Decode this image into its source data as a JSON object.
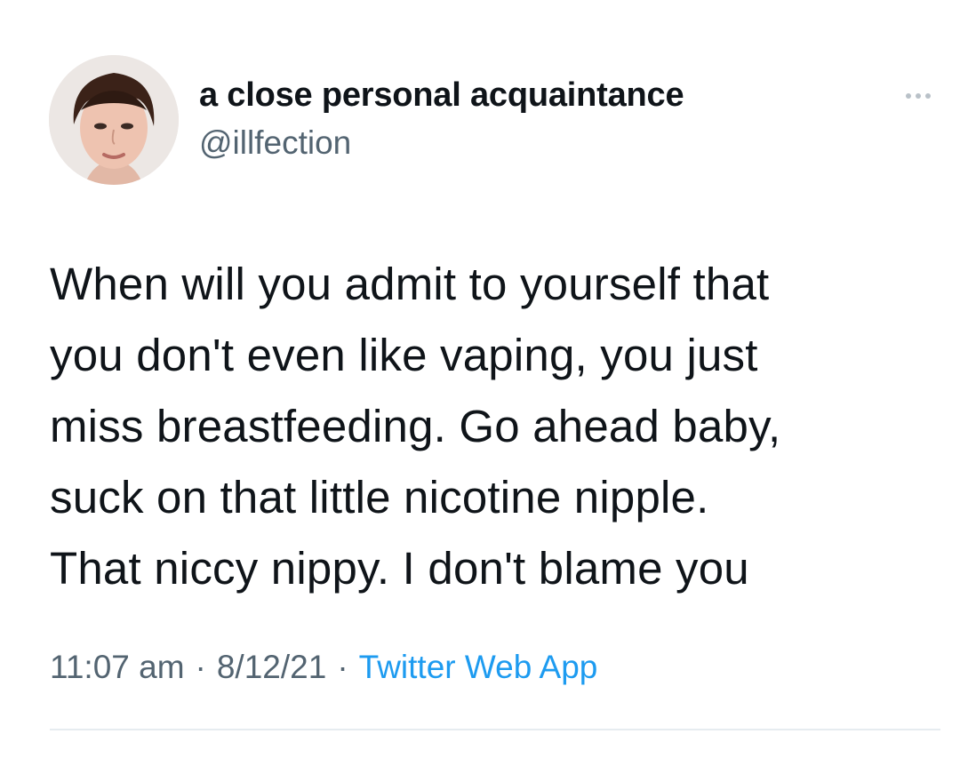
{
  "user": {
    "display_name": "a close personal acquaintance",
    "handle": "@illfection",
    "avatar_icon": "profile-photo-avatar"
  },
  "tweet": {
    "lines": [
      "When will you admit to yourself that",
      "you don't even like vaping, you just",
      "miss breastfeeding. Go ahead baby,",
      "suck on that little nicotine nipple.",
      "That niccy nippy. I don't blame you"
    ]
  },
  "meta": {
    "time": "11:07 am",
    "separator": "·",
    "date": "8/12/21",
    "source": "Twitter Web App"
  },
  "icons": {
    "more": "more-options-icon"
  },
  "colors": {
    "text": "#0f1419",
    "secondary": "#536471",
    "link": "#1d9bf0",
    "divider": "#e6ecf0"
  }
}
